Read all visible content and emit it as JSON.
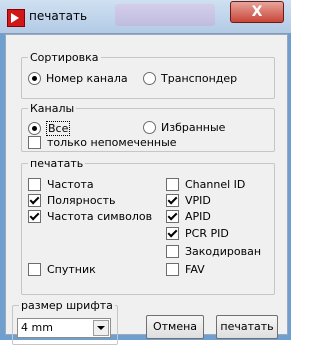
{
  "window": {
    "title": "печатать",
    "close_label": "X"
  },
  "sorting": {
    "legend": "Сортировка",
    "options": [
      {
        "label": "Номер канала",
        "checked": true
      },
      {
        "label": "Транспондер",
        "checked": false
      }
    ]
  },
  "channels": {
    "legend": "Каналы",
    "options": [
      {
        "label": "Все",
        "checked": true
      },
      {
        "label": "Избранные",
        "checked": false
      }
    ],
    "only_unmarked": {
      "label": "только непомеченные",
      "checked": false
    }
  },
  "print": {
    "legend": "печатать",
    "left": [
      {
        "label": "Частота",
        "checked": false
      },
      {
        "label": "Полярность",
        "checked": true
      },
      {
        "label": "Частота символов",
        "checked": true
      },
      {
        "label": "Спутник",
        "checked": false
      }
    ],
    "right": [
      {
        "label": "Channel ID",
        "checked": false
      },
      {
        "label": "VPID",
        "checked": true
      },
      {
        "label": "APID",
        "checked": true
      },
      {
        "label": "PCR PID",
        "checked": true
      },
      {
        "label": "Закодирован",
        "checked": false
      },
      {
        "label": "FAV",
        "checked": false
      }
    ]
  },
  "font_size": {
    "legend": "размер шрифта",
    "value": "4 mm"
  },
  "buttons": {
    "cancel": "Отмена",
    "print": "печатать"
  }
}
